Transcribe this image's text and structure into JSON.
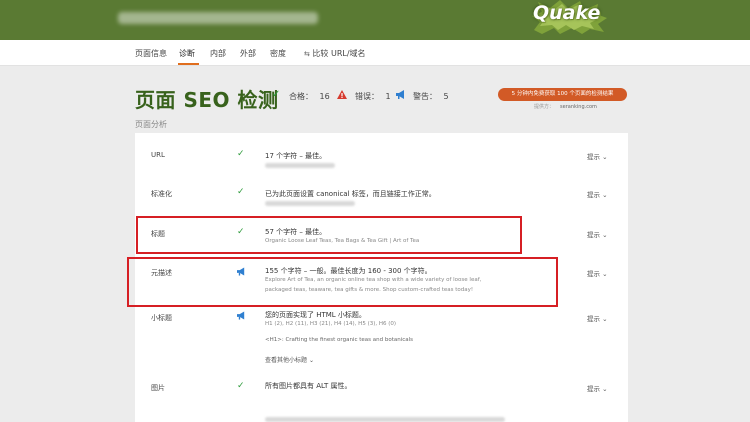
{
  "logo": {
    "text": "Quake"
  },
  "nav": {
    "items": [
      "页面信息",
      "诊断",
      "内部",
      "外部",
      "密度",
      "比较 URL/域名"
    ],
    "active_index": 1
  },
  "header": {
    "title": "页面 SEO 检测",
    "summary": {
      "pass_label": "合格：",
      "pass_count": "16",
      "error_label": "错误：",
      "error_count": "1",
      "warning_label": "警告：",
      "warning_count": "5"
    },
    "promo": "5 分钟内免费获取 100 个页面的检测结果",
    "powered_label": "提供方：",
    "powered_by": "seranking.com"
  },
  "section_label": "页面分析",
  "hint_label": "提示",
  "rows": [
    {
      "label": "URL",
      "status": "pass",
      "main": "17 个字符 – 最佳。",
      "sub": ""
    },
    {
      "label": "标准化",
      "status": "pass",
      "main": "已为此页面设置 canonical 标签，而且链接工作正常。",
      "sub": ""
    },
    {
      "label": "标题",
      "status": "pass",
      "main": "57 个字符 – 最佳。",
      "sub": "Organic Loose Leaf Teas, Tea Bags & Tea Gift | Art of Tea"
    },
    {
      "label": "元描述",
      "status": "warning",
      "main": "155 个字符 – 一般。最佳长度为 160 - 300 个字符。",
      "sub": "Explore Art of Tea, an organic online tea shop with a wide variety of loose leaf,",
      "sub2": "packaged teas, teaware, tea gifts & more. Shop custom-crafted teas today!"
    },
    {
      "label": "小标题",
      "status": "warning",
      "main": "您的页面实现了 HTML 小标题。",
      "sub": "H1 (2), H2 (11), H3 (21), H4 (14), H5 (3), H6 (0)",
      "sub2": "<H1>: Crafting the finest organic teas and botanicals",
      "more": "查看其他小标题"
    },
    {
      "label": "图片",
      "status": "pass",
      "main": "所有图片都具有 ALT 属性。",
      "sub": ""
    }
  ],
  "colors": {
    "brand_green": "#5a7a33",
    "title_green": "#38621c",
    "accent_orange": "#d25a26",
    "pass": "#2e9b3c",
    "error": "#d63a2e",
    "warning": "#2f7fd0",
    "highlight": "#d61f24"
  },
  "icons": {
    "pass": "check-icon",
    "error": "error-triangle-icon",
    "warning": "megaphone-icon",
    "hint": "chevron-down-icon"
  }
}
